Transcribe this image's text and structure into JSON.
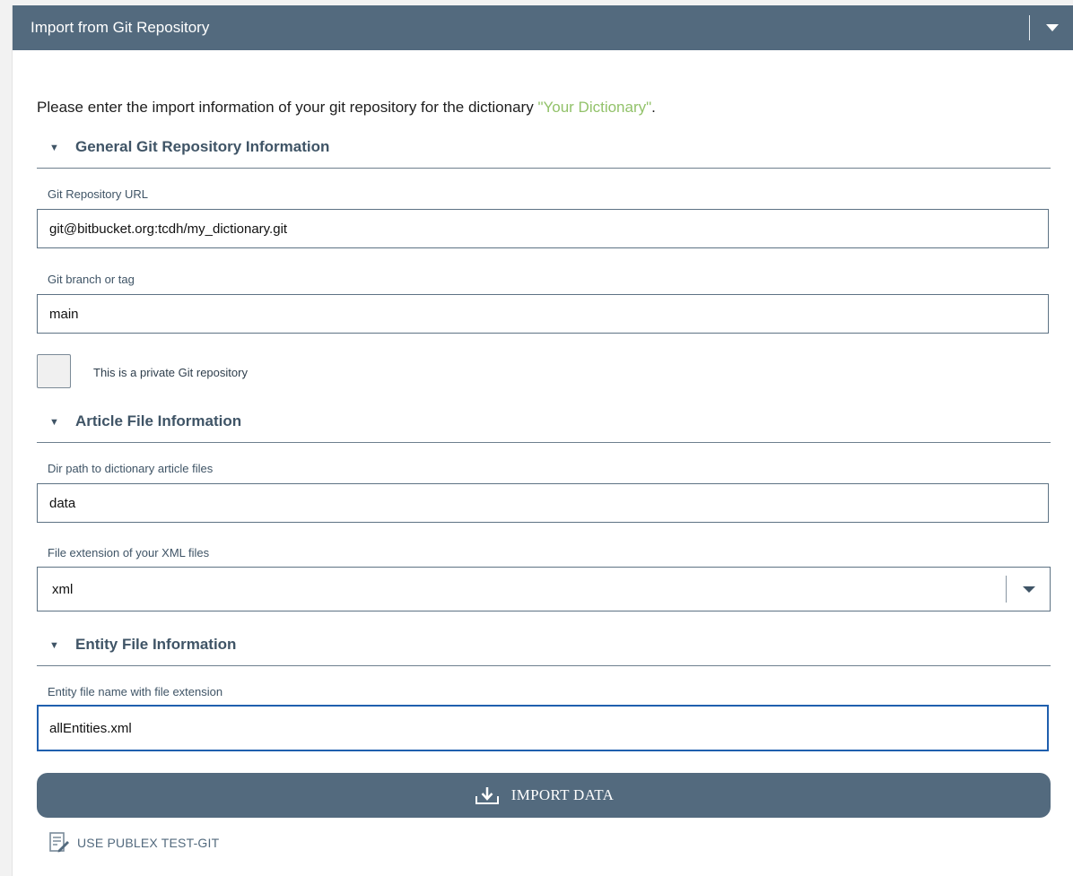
{
  "panel": {
    "title": "Import from Git Repository"
  },
  "intro": {
    "prefix": "Please enter the import information of your git repository for the dictionary ",
    "dictionary_name": "\"Your Dictionary\"",
    "suffix": "."
  },
  "sections": {
    "general": {
      "caret": "▼",
      "title": "General Git Repository Information"
    },
    "article": {
      "caret": "▼",
      "title": "Article File Information"
    },
    "entity": {
      "caret": "▼",
      "title": "Entity File Information"
    }
  },
  "fields": {
    "repo_url": {
      "label": "Git Repository URL",
      "value": "git@bitbucket.org:tcdh/my_dictionary.git"
    },
    "branch": {
      "label": "Git branch or tag",
      "value": "main"
    },
    "private_repo": {
      "label": "This is a private Git repository",
      "checked": false
    },
    "dir_path": {
      "label": "Dir path to dictionary article files",
      "value": "data"
    },
    "file_extension": {
      "label": "File extension of your XML files",
      "value": "xml"
    },
    "entity_file": {
      "label": "Entity file name with file extension",
      "value": "allEntities.xml"
    }
  },
  "actions": {
    "import_label": "IMPORT DATA",
    "import_icon": "download-icon",
    "test_git_label": "USE PUBLEX TEST-GIT",
    "test_git_icon": "edit-document-icon"
  },
  "colors": {
    "header_bg": "#536a7e",
    "accent_green": "#92c26a",
    "focus_border": "#1f5fae",
    "section_text": "#3f5466"
  }
}
